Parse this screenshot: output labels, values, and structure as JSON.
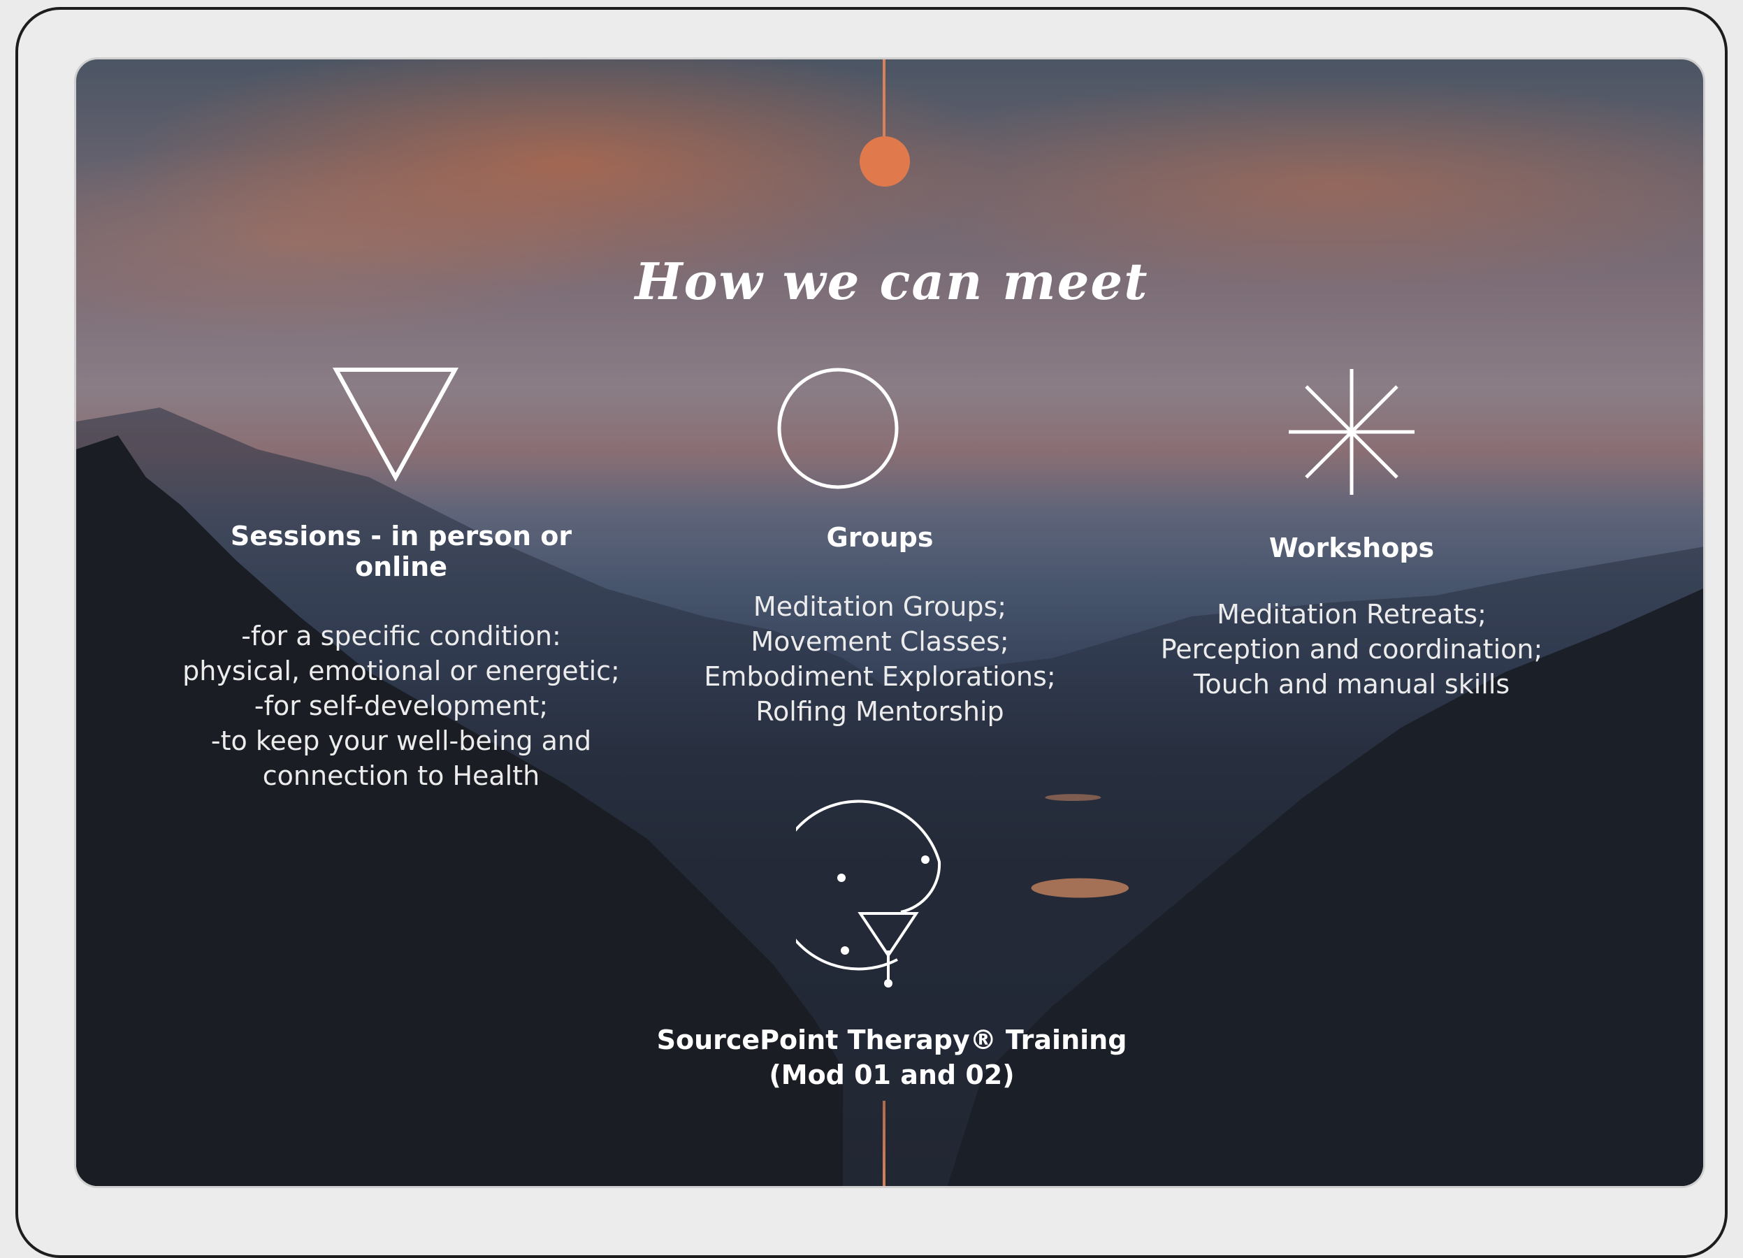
{
  "title": "How we can meet",
  "columns": [
    {
      "heading": "Sessions - in person or online",
      "icon": "triangle-icon",
      "lines": [
        "-for a specific condition:",
        "physical, emotional or energetic;",
        "-for self-development;",
        "-to keep your well-being and",
        "connection to Health"
      ]
    },
    {
      "heading": "Groups",
      "icon": "circle-icon",
      "lines": [
        "Meditation Groups;",
        "Movement Classes;",
        "Embodiment Explorations;",
        "Rolfing Mentorship"
      ]
    },
    {
      "heading": "Workshops",
      "icon": "star-burst-icon",
      "lines": [
        "Meditation Retreats;",
        "Perception and coordination;",
        "Touch and manual skills"
      ]
    }
  ],
  "training": {
    "icon": "sourcepoint-logo-icon",
    "line1": "SourcePoint Therapy® Training",
    "line2": "(Mod 01 and 02)"
  },
  "colors": {
    "accent": "#e07a4d",
    "text": "#ffffff",
    "frame": "#1d1d1d"
  }
}
